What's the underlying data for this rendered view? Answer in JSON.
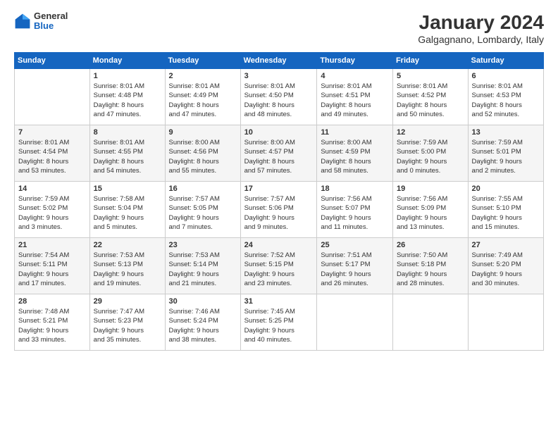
{
  "logo": {
    "general": "General",
    "blue": "Blue"
  },
  "title": "January 2024",
  "location": "Galgagnano, Lombardy, Italy",
  "days_of_week": [
    "Sunday",
    "Monday",
    "Tuesday",
    "Wednesday",
    "Thursday",
    "Friday",
    "Saturday"
  ],
  "weeks": [
    [
      {
        "day": "",
        "info": ""
      },
      {
        "day": "1",
        "info": "Sunrise: 8:01 AM\nSunset: 4:48 PM\nDaylight: 8 hours\nand 47 minutes."
      },
      {
        "day": "2",
        "info": "Sunrise: 8:01 AM\nSunset: 4:49 PM\nDaylight: 8 hours\nand 47 minutes."
      },
      {
        "day": "3",
        "info": "Sunrise: 8:01 AM\nSunset: 4:50 PM\nDaylight: 8 hours\nand 48 minutes."
      },
      {
        "day": "4",
        "info": "Sunrise: 8:01 AM\nSunset: 4:51 PM\nDaylight: 8 hours\nand 49 minutes."
      },
      {
        "day": "5",
        "info": "Sunrise: 8:01 AM\nSunset: 4:52 PM\nDaylight: 8 hours\nand 50 minutes."
      },
      {
        "day": "6",
        "info": "Sunrise: 8:01 AM\nSunset: 4:53 PM\nDaylight: 8 hours\nand 52 minutes."
      }
    ],
    [
      {
        "day": "7",
        "info": "Sunrise: 8:01 AM\nSunset: 4:54 PM\nDaylight: 8 hours\nand 53 minutes."
      },
      {
        "day": "8",
        "info": "Sunrise: 8:01 AM\nSunset: 4:55 PM\nDaylight: 8 hours\nand 54 minutes."
      },
      {
        "day": "9",
        "info": "Sunrise: 8:00 AM\nSunset: 4:56 PM\nDaylight: 8 hours\nand 55 minutes."
      },
      {
        "day": "10",
        "info": "Sunrise: 8:00 AM\nSunset: 4:57 PM\nDaylight: 8 hours\nand 57 minutes."
      },
      {
        "day": "11",
        "info": "Sunrise: 8:00 AM\nSunset: 4:59 PM\nDaylight: 8 hours\nand 58 minutes."
      },
      {
        "day": "12",
        "info": "Sunrise: 7:59 AM\nSunset: 5:00 PM\nDaylight: 9 hours\nand 0 minutes."
      },
      {
        "day": "13",
        "info": "Sunrise: 7:59 AM\nSunset: 5:01 PM\nDaylight: 9 hours\nand 2 minutes."
      }
    ],
    [
      {
        "day": "14",
        "info": "Sunrise: 7:59 AM\nSunset: 5:02 PM\nDaylight: 9 hours\nand 3 minutes."
      },
      {
        "day": "15",
        "info": "Sunrise: 7:58 AM\nSunset: 5:04 PM\nDaylight: 9 hours\nand 5 minutes."
      },
      {
        "day": "16",
        "info": "Sunrise: 7:57 AM\nSunset: 5:05 PM\nDaylight: 9 hours\nand 7 minutes."
      },
      {
        "day": "17",
        "info": "Sunrise: 7:57 AM\nSunset: 5:06 PM\nDaylight: 9 hours\nand 9 minutes."
      },
      {
        "day": "18",
        "info": "Sunrise: 7:56 AM\nSunset: 5:07 PM\nDaylight: 9 hours\nand 11 minutes."
      },
      {
        "day": "19",
        "info": "Sunrise: 7:56 AM\nSunset: 5:09 PM\nDaylight: 9 hours\nand 13 minutes."
      },
      {
        "day": "20",
        "info": "Sunrise: 7:55 AM\nSunset: 5:10 PM\nDaylight: 9 hours\nand 15 minutes."
      }
    ],
    [
      {
        "day": "21",
        "info": "Sunrise: 7:54 AM\nSunset: 5:11 PM\nDaylight: 9 hours\nand 17 minutes."
      },
      {
        "day": "22",
        "info": "Sunrise: 7:53 AM\nSunset: 5:13 PM\nDaylight: 9 hours\nand 19 minutes."
      },
      {
        "day": "23",
        "info": "Sunrise: 7:53 AM\nSunset: 5:14 PM\nDaylight: 9 hours\nand 21 minutes."
      },
      {
        "day": "24",
        "info": "Sunrise: 7:52 AM\nSunset: 5:15 PM\nDaylight: 9 hours\nand 23 minutes."
      },
      {
        "day": "25",
        "info": "Sunrise: 7:51 AM\nSunset: 5:17 PM\nDaylight: 9 hours\nand 26 minutes."
      },
      {
        "day": "26",
        "info": "Sunrise: 7:50 AM\nSunset: 5:18 PM\nDaylight: 9 hours\nand 28 minutes."
      },
      {
        "day": "27",
        "info": "Sunrise: 7:49 AM\nSunset: 5:20 PM\nDaylight: 9 hours\nand 30 minutes."
      }
    ],
    [
      {
        "day": "28",
        "info": "Sunrise: 7:48 AM\nSunset: 5:21 PM\nDaylight: 9 hours\nand 33 minutes."
      },
      {
        "day": "29",
        "info": "Sunrise: 7:47 AM\nSunset: 5:23 PM\nDaylight: 9 hours\nand 35 minutes."
      },
      {
        "day": "30",
        "info": "Sunrise: 7:46 AM\nSunset: 5:24 PM\nDaylight: 9 hours\nand 38 minutes."
      },
      {
        "day": "31",
        "info": "Sunrise: 7:45 AM\nSunset: 5:25 PM\nDaylight: 9 hours\nand 40 minutes."
      },
      {
        "day": "",
        "info": ""
      },
      {
        "day": "",
        "info": ""
      },
      {
        "day": "",
        "info": ""
      }
    ]
  ]
}
